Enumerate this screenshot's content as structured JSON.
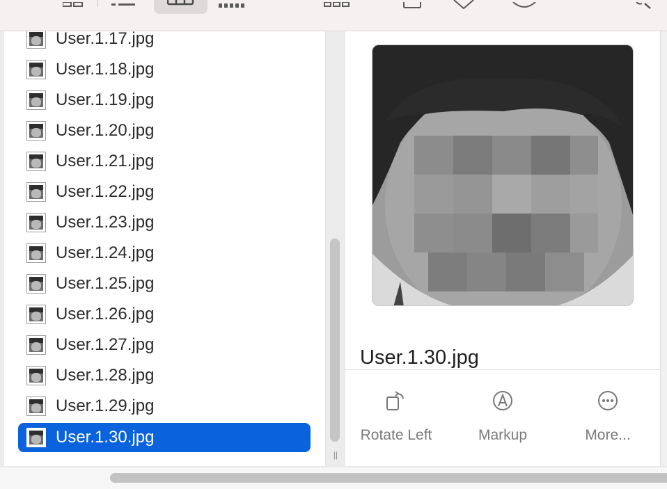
{
  "toolbar": {
    "view_buttons": [
      "icon-view",
      "list-view",
      "column-view",
      "gallery-view"
    ],
    "selected_view": "column-view",
    "icons": [
      "grid-icon",
      "list-icon",
      "columns-icon",
      "gallery-icon",
      "group-icon",
      "share-icon",
      "tag-icon",
      "action-icon",
      "search-icon"
    ]
  },
  "files": [
    {
      "name": "User.1.17.jpg"
    },
    {
      "name": "User.1.18.jpg"
    },
    {
      "name": "User.1.19.jpg"
    },
    {
      "name": "User.1.20.jpg"
    },
    {
      "name": "User.1.21.jpg"
    },
    {
      "name": "User.1.22.jpg"
    },
    {
      "name": "User.1.23.jpg"
    },
    {
      "name": "User.1.24.jpg"
    },
    {
      "name": "User.1.25.jpg"
    },
    {
      "name": "User.1.26.jpg"
    },
    {
      "name": "User.1.27.jpg"
    },
    {
      "name": "User.1.28.jpg"
    },
    {
      "name": "User.1.29.jpg"
    },
    {
      "name": "User.1.30.jpg",
      "selected": true
    }
  ],
  "preview": {
    "filename": "User.1.30.jpg",
    "actions": [
      {
        "label": "Rotate Left",
        "icon": "rotate-left-icon"
      },
      {
        "label": "Markup",
        "icon": "markup-icon"
      },
      {
        "label": "More...",
        "icon": "more-icon"
      }
    ]
  },
  "colors": {
    "selection": "#0a63dd",
    "toolbar_bg": "#f6f1f1"
  }
}
